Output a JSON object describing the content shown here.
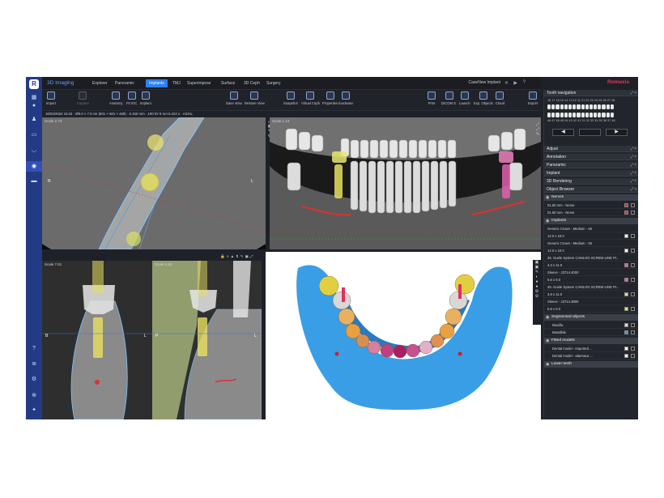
{
  "app": {
    "title": "3D Imaging",
    "case": "CaseNew Implant",
    "brand": "Romexis"
  },
  "menu": [
    "Explorer",
    "Panoramic",
    "Implants",
    "TMJ",
    "Superimpose",
    "Surface",
    "3D Ceph",
    "Surgery"
  ],
  "active_menu": "Implants",
  "toolbar": {
    "import": "Import",
    "capture": "Capture",
    "anatomy": "Anatomy",
    "fit_ioc": "Fit IOC",
    "implant": "Implant",
    "save_view": "Save View",
    "restore_view": "Restore View",
    "snapshot": "Snapshot",
    "virtual_ceph": "Virtual Ceph",
    "properties": "Properties",
    "inactivate": "Inactivate",
    "print": "Print",
    "dicom_s": "DICOM S.",
    "launch": "Launch",
    "exp_objects": "Exp. Objects",
    "cloud": "Cloud",
    "export": "Export"
  },
  "info_line": "16/04/2024 15:34 · Ø9.0 × 7.0 cm (601 × 601 × 468) · 0.150 mm · 100 kV 9 mA 6.222 s · AXIAL",
  "viewports": {
    "axial": {
      "scale": "Scale 2.74",
      "left_marker": "R",
      "right_marker": "L"
    },
    "panoramic": {
      "scale": "Scale 1.13"
    },
    "cross1": {
      "scale": "Scale 7.61",
      "left_marker": "B",
      "right_marker": "L"
    },
    "cross2": {
      "scale": "Scale 1.63",
      "left_marker": "P",
      "right_marker": "L"
    }
  },
  "panel": {
    "tooth_navigation": "Tooth navigation",
    "upper_numbers": "18 17 16 15 14 13 12 11 21 22 23 24 25 26 27 28",
    "lower_numbers": "48 47 46 45 44 43 42 41 31 32 33 34 35 36 37 38",
    "prev": "◀",
    "next": "▶",
    "sections": [
      "Adjust",
      "Annotation",
      "Panoramic",
      "Implant",
      "3D Rendering",
      "Object Browser"
    ],
    "object_browser": {
      "nerves_header": "Nerves",
      "nerves": [
        "01.50 mm - Nerve",
        "01.50 mm - Nerve"
      ],
      "implants_header": "Implants",
      "implants": [
        "Generic Crown - Medium - 46",
        "12.0 x 10.0",
        "Generic Crown - Medium - 36",
        "12.0 x 10.0",
        "36. Guide System CAMLOG SCREW-LINE Pr...",
        "4.3 x 11.0",
        "Sleeve - J3714.4000",
        "5.6 x 5.0",
        "46. Guide System CAMLOG SCREW-LINE Pr...",
        "3.8 x 11.0",
        "Sleeve - J3714.3800",
        "5.6 x 5.0"
      ],
      "segmented_header": "Segmented objects",
      "segmented": [
        "Maxilla",
        "Mandible"
      ],
      "fitted_header": "Fitted models",
      "fitted": [
        "Dental model - Imported ...",
        "Dental model - alarmaux ..."
      ],
      "lower_teeth": "Lower teeth"
    }
  },
  "colors": {
    "accent": "#2d7ff9",
    "brand": "#e43a56",
    "rail": "#233a84",
    "nerve": "#e03030",
    "implant_yellow": "#e8e060",
    "implant_pink": "#e060b0",
    "bone_blue": "#3aa0e8"
  }
}
